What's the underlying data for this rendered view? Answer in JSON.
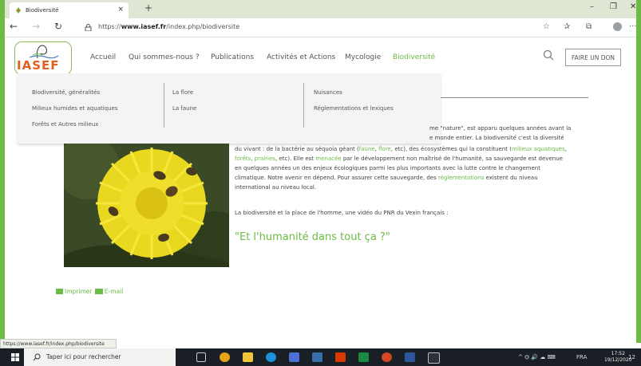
{
  "browser": {
    "tab_title": "Biodiversité",
    "tab_close": "×",
    "new_tab": "+",
    "minimize": "–",
    "maximize": "❐",
    "close": "✕",
    "back": "←",
    "forward": "→",
    "refresh": "↻",
    "url_scheme": "https://",
    "url_host": "www.iasef.fr",
    "url_path": "/index.php/biodiversite",
    "more": "···",
    "status_url": "https://www.iasef.fr/index.php/biodiversite"
  },
  "site": {
    "logo_text": "IASEF",
    "menu": [
      "Accueil",
      "Qui sommes-nous ?",
      "Publications",
      "Activités et Actions",
      "Mycologie",
      "Biodiversité"
    ],
    "active_menu": "Biodiversité",
    "donate_label": "FAIRE UN DON",
    "dropdown": {
      "col1": [
        "Biodiversité, généralités",
        "Milieux humides et aquatiques",
        "Forêts et Autres milieux"
      ],
      "col2": [
        "La flore",
        "La faune"
      ],
      "col3": [
        "Nuisances",
        "Réglementations et lexiques"
      ]
    }
  },
  "article": {
    "frag1": "me \"nature\", est apparu quelques années avant la",
    "frag2": "e monde entier. La biodiversité c'est la diversité",
    "line3_a": "du vivant : de la bactérie au séquoia géant (",
    "faune": "faune",
    "comma": ", ",
    "flore": "flore",
    "line3_b": ", etc), des écosystèmes qui la constituent (",
    "milieux": "milieux aquatiques",
    "comma2": ",",
    "forets": "forêts",
    "prairies": "prairies",
    "line4_b": ", etc). Elle est ",
    "menacee": "menacée",
    "line4_c": " par le développement non maîtrisé de l'humanité, sa sauvegarde est devenue",
    "line5": "en quelques années un des enjeux écologiques parmi les plus importants avec la lutte contre le changement",
    "line6_a": "climatique. Notre avenir en dépend. Pour assurer cette sauvegarde, des ",
    "reglementations": "réglementations",
    "line6_b": " existent du niveau",
    "line7": "international au niveau local.",
    "para2": "La biodiversité et la place de l'homme, une vidéo du PNR du Vexin français :",
    "quote": "\"Et l'humanité dans tout ça ?\"",
    "print_label": "Imprimer",
    "email_label": "E-mail"
  },
  "taskbar": {
    "search_placeholder": "Taper ici pour rechercher",
    "tray_icons": "^ ⏣ 🔊 ☁ ⌨",
    "lang": "FRA",
    "time": "17:52",
    "date": "19/12/2020",
    "notif": "12"
  },
  "colors": {
    "accent_green": "#6cbb46",
    "logo_orange": "#e06020",
    "taskbar_bg": "#1a1f25"
  }
}
